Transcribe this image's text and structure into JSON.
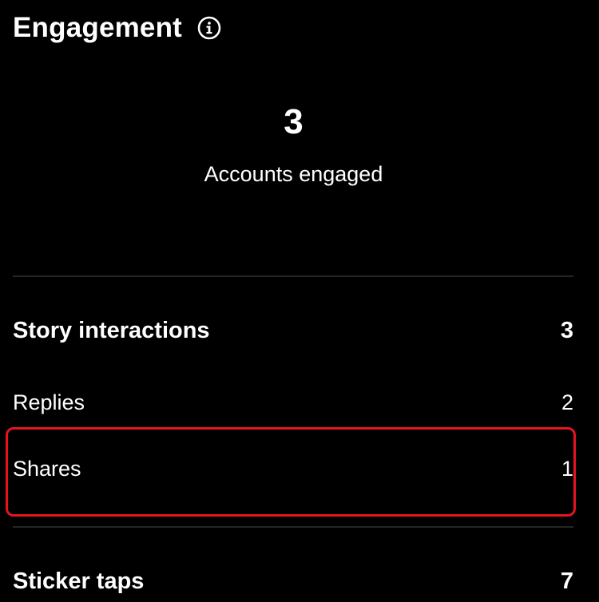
{
  "header": {
    "title": "Engagement",
    "info_icon": "info-icon"
  },
  "summary": {
    "value": "3",
    "label": "Accounts engaged"
  },
  "sections": [
    {
      "label": "Story interactions",
      "value": "3",
      "items": [
        {
          "label": "Replies",
          "value": "2"
        },
        {
          "label": "Shares",
          "value": "1"
        }
      ]
    },
    {
      "label": "Sticker taps",
      "value": "7"
    }
  ],
  "highlight": {
    "target": "Shares",
    "color": "#e5141f"
  },
  "colors": {
    "background": "#000000",
    "text": "#ffffff",
    "divider": "#262626"
  }
}
